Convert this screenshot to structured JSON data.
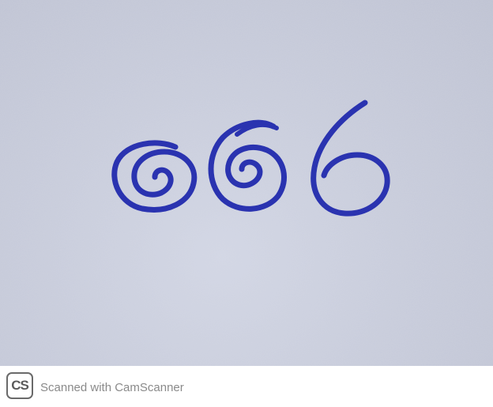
{
  "image": {
    "handwritten_digits": "666",
    "ink_color": "#2a33b0",
    "paper_color": "#c9cddc"
  },
  "footer": {
    "logo_text": "CS",
    "watermark_text": "Scanned with CamScanner"
  }
}
